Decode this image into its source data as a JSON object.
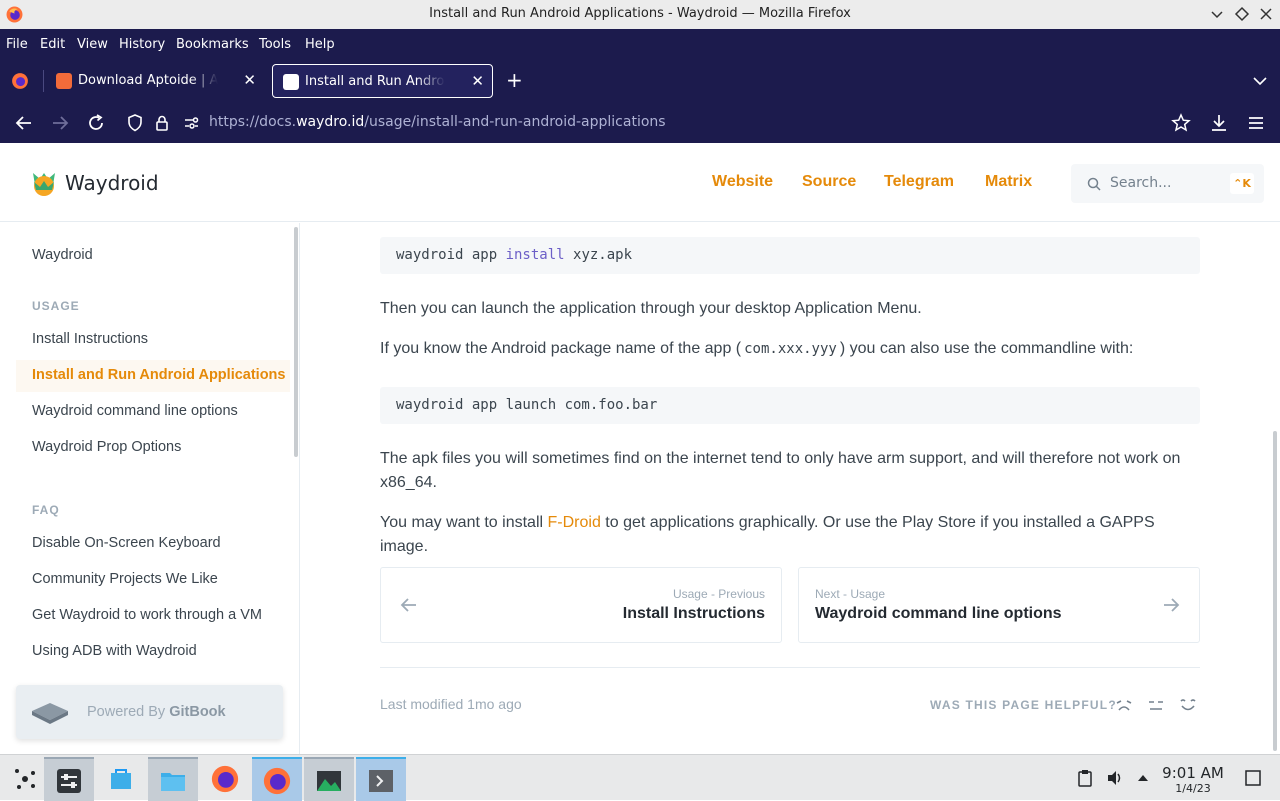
{
  "window": {
    "title": "Install and Run Android Applications - Waydroid — Mozilla Firefox"
  },
  "menu": [
    "File",
    "Edit",
    "View",
    "History",
    "Bookmarks",
    "Tools",
    "Help"
  ],
  "tabs": [
    {
      "label": "Download Aptoide | Aptoide",
      "active": false
    },
    {
      "label": "Install and Run Android Applications",
      "active": true
    }
  ],
  "nav": {
    "url_prefix": "https://docs.",
    "url_host": "waydro.id",
    "url_path": "/usage/install-and-run-android-applications"
  },
  "header": {
    "brand": "Waydroid",
    "links": [
      "Website",
      "Source",
      "Telegram",
      "Matrix"
    ],
    "search_placeholder": "Search...",
    "search_shortcut": "⌃K"
  },
  "sidebar": {
    "top_item": "Waydroid",
    "section_usage": "USAGE",
    "usage_items": [
      "Install Instructions",
      "Install and Run Android Applications",
      "Waydroid command line options",
      "Waydroid Prop Options"
    ],
    "section_faq": "FAQ",
    "faq_items": [
      "Disable On-Screen Keyboard",
      "Community Projects We Like",
      "Get Waydroid to work through a VM",
      "Using ADB with Waydroid"
    ],
    "powered_prefix": "Powered By ",
    "powered_brand": "GitBook"
  },
  "content": {
    "code1_a": "waydroid app ",
    "code1_kw": "install",
    "code1_b": " xyz.apk",
    "p1": "Then you can launch the application through your desktop Application Menu.",
    "p2_a": "If you know the Android package name of the app (",
    "p2_code": "com.xxx.yyy",
    "p2_b": ") you can also use the commandline with:",
    "code2": "waydroid app launch com.foo.bar",
    "p3": "The apk files you will sometimes find on the internet tend to only have arm support, and will therefore not work on x86_64.",
    "p4_a": "You may want to install ",
    "p4_link": "F-Droid",
    "p4_b": " to get applications graphically. Or use the Play Store if you installed a GAPPS image.",
    "prev_small": "Usage - Previous",
    "prev_title": "Install Instructions",
    "next_small": "Next - Usage",
    "next_title": "Waydroid command line options",
    "last_modified": "Last modified 1mo ago",
    "helpful": "WAS THIS PAGE HELPFUL?"
  },
  "taskbar": {
    "time": "9:01 AM",
    "date": "1/4/23"
  },
  "colors": {
    "accent": "#e58a0a",
    "browser_chrome": "#1c1b4d"
  }
}
